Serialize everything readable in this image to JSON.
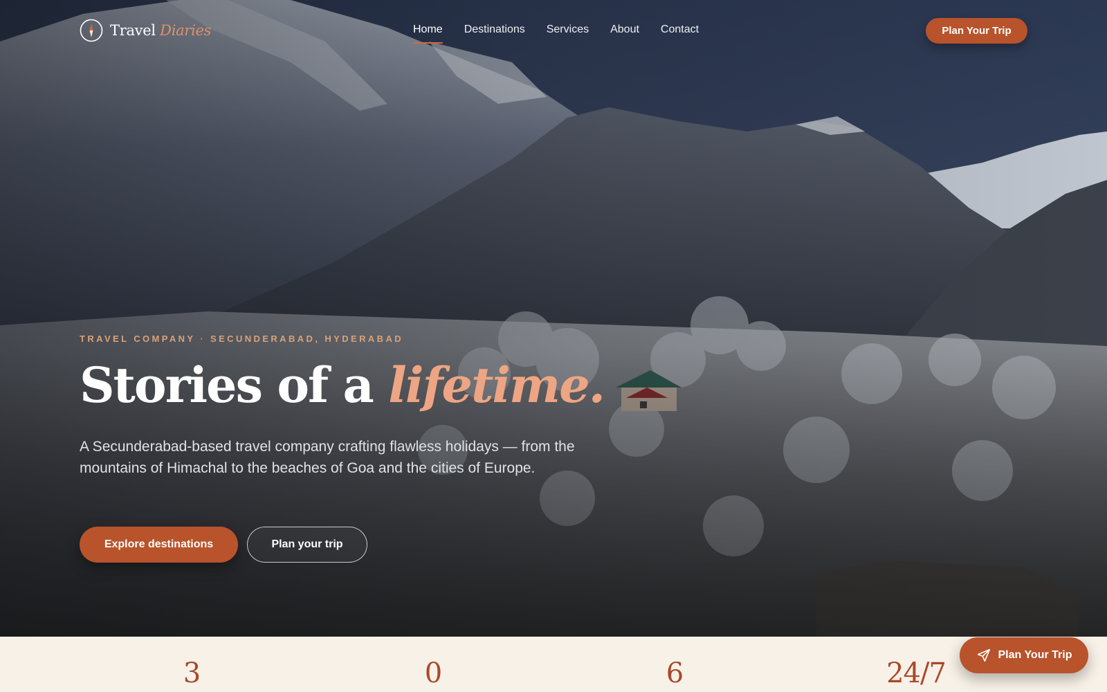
{
  "brand": {
    "name_primary": "Travel",
    "name_accent": "Diaries",
    "accent_color": "#b8532c",
    "highlight_color": "#eea583"
  },
  "nav": {
    "items": [
      {
        "label": "Home",
        "active": true
      },
      {
        "label": "Destinations",
        "active": false
      },
      {
        "label": "Services",
        "active": false
      },
      {
        "label": "About",
        "active": false
      },
      {
        "label": "Contact",
        "active": false
      }
    ],
    "cta_label": "Plan Your Trip"
  },
  "hero": {
    "eyebrow_left": "TRAVEL COMPANY",
    "eyebrow_sep": "·",
    "eyebrow_right": "SECUNDERABAD, HYDERABAD",
    "headline_main": "Stories of a ",
    "headline_accent": "lifetime.",
    "lede": "A Secunderabad-based travel company crafting flawless holidays — from the mountains of Himachal to the beaches of Goa and the cities of Europe.",
    "primary_button": "Explore destinations",
    "secondary_button": "Plan your trip",
    "background": "snowy-mountain-valley-photo"
  },
  "stats": {
    "values": [
      "3",
      "0",
      "6",
      "24/7"
    ]
  },
  "floating_cta": {
    "label": "Plan Your Trip",
    "icon": "paper-plane-icon"
  }
}
